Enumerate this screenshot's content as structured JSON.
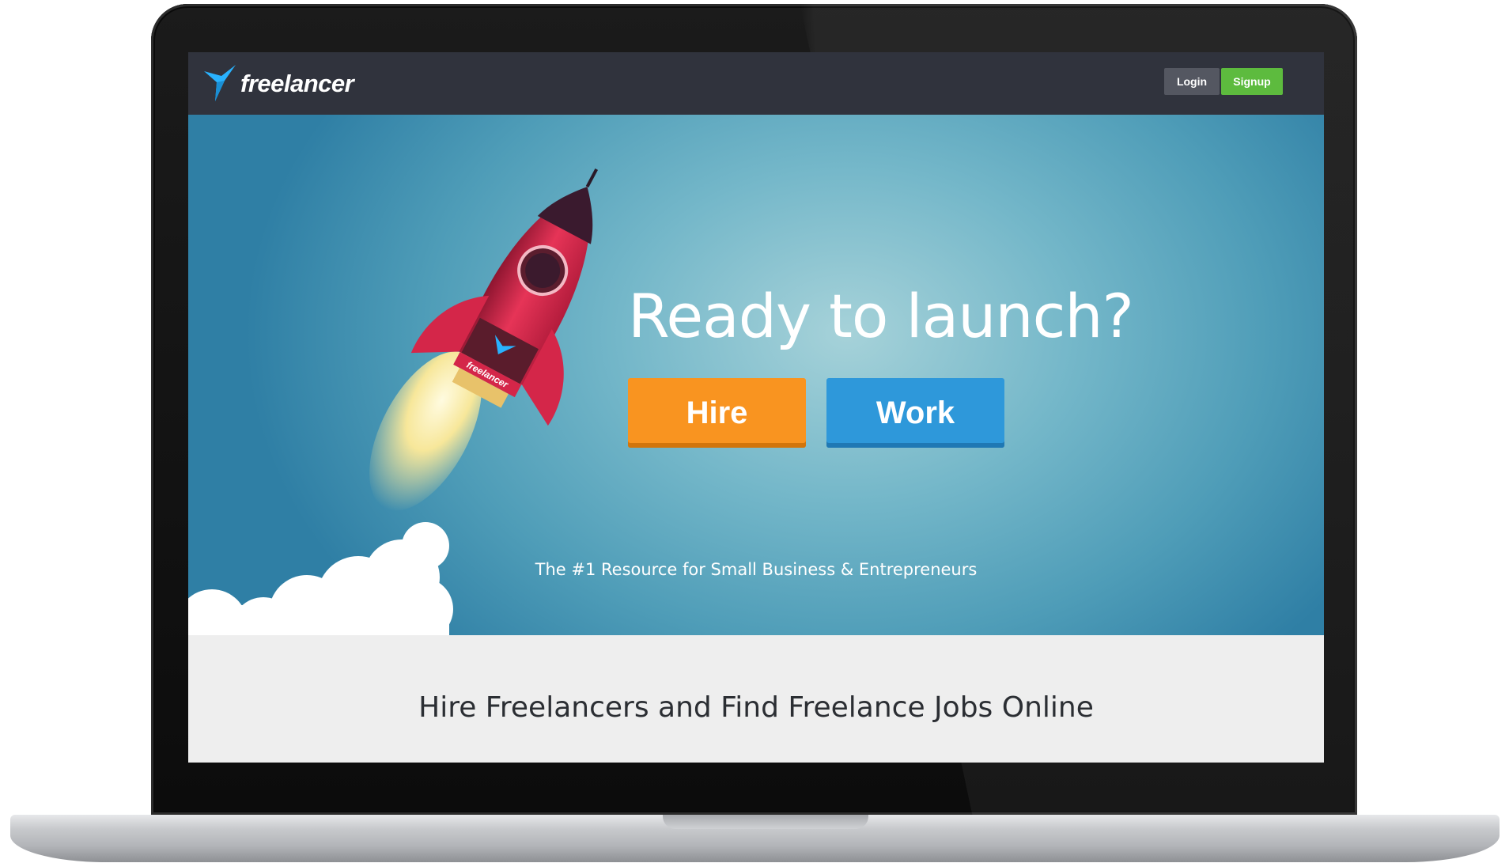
{
  "nav": {
    "logo_text": "freelancer",
    "login_label": "Login",
    "signup_label": "Signup"
  },
  "hero": {
    "headline": "Ready to launch?",
    "hire_label": "Hire",
    "work_label": "Work",
    "tagline": "The #1 Resource for Small Business & Entrepreneurs",
    "rocket_badge": "freelancer"
  },
  "section": {
    "title": "Hire Freelancers and Find Freelance Jobs Online"
  },
  "colors": {
    "nav_bg": "#30333d",
    "signup_green": "#5dbb3e",
    "hire_orange": "#f99420",
    "work_blue": "#2e98da",
    "brand_blue": "#29b2fe"
  }
}
